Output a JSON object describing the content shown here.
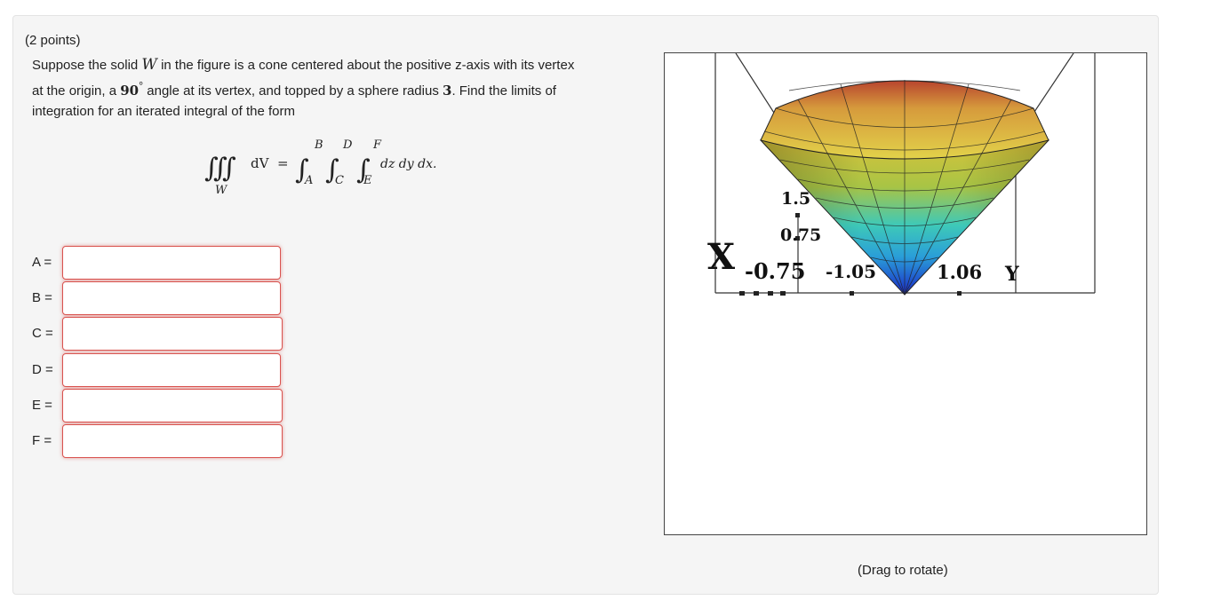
{
  "problem": {
    "points": "(2 points)",
    "line1_before": "Suppose the solid ",
    "solid_var": "W",
    "line1_after": " in the figure is a cone centered about the positive z-axis with its vertex",
    "line2_before": "at the origin, a ",
    "angle": "90",
    "degree_symbol": "°",
    "line2_mid": " angle at its vertex, and topped by a sphere radius ",
    "radius": "3",
    "line2_after": ". Find the limits of",
    "line3": "integration for an iterated integral of the form"
  },
  "formula": {
    "triple_integral": "∭",
    "region": "W",
    "dV": "dV",
    "equals": "=",
    "integral": "∫",
    "upper_limits": [
      "B",
      "D",
      "F"
    ],
    "lower_limits": [
      "A",
      "C",
      "E"
    ],
    "differentials": "dz dy dx."
  },
  "fields": [
    {
      "label": "A =",
      "value": ""
    },
    {
      "label": "B =",
      "value": ""
    },
    {
      "label": "C =",
      "value": ""
    },
    {
      "label": "D =",
      "value": ""
    },
    {
      "label": "E =",
      "value": ""
    },
    {
      "label": "F =",
      "value": ""
    }
  ],
  "plot": {
    "tick_labels": [
      "1.5",
      "0.75",
      "X",
      "-0.75",
      "-1.05",
      "1.06",
      "Y"
    ],
    "hint": "(Drag to rotate)"
  }
}
